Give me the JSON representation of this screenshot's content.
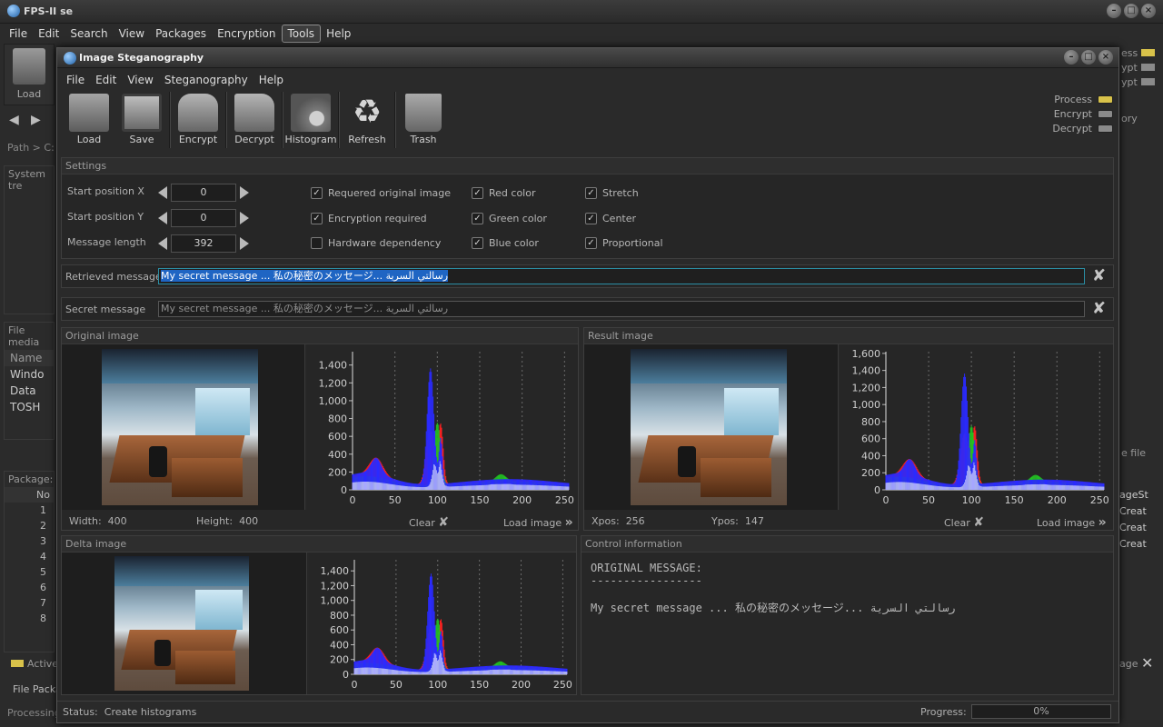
{
  "app": {
    "title": "FPS-II se",
    "menu": [
      "File",
      "Edit",
      "Search",
      "View",
      "Packages",
      "Encryption",
      "Tools",
      "Help"
    ],
    "active_menu": "Tools",
    "background": {
      "load_label": "Load",
      "path_label": "Path >",
      "path_value": "C:",
      "system_tree": "System tre",
      "file_media": "File media",
      "name_col": "Name",
      "drives": [
        "Windo",
        "Data",
        "TOSH"
      ],
      "package_label": "Package:",
      "no_col": "No",
      "rows": [
        "1",
        "2",
        "3",
        "4",
        "5",
        "6",
        "7",
        "8"
      ],
      "active_label": "Active",
      "file_package": "File Packa",
      "processing": "Processing",
      "right_frag": [
        "ess",
        "ypt",
        "ypt",
        "ory",
        "e file",
        "ageSt",
        "Creat",
        "Creat",
        "Creat",
        "age"
      ]
    }
  },
  "dialog": {
    "title": "Image Steganography",
    "menu": [
      "File",
      "Edit",
      "View",
      "Steganography",
      "Help"
    ],
    "toolbar": [
      {
        "label": "Load",
        "icon": "load-box-icon"
      },
      {
        "label": "Save",
        "icon": "floppy-disk-icon"
      },
      {
        "label": "Encrypt",
        "icon": "lock-icon"
      },
      {
        "label": "Decrypt",
        "icon": "unlock-icon"
      },
      {
        "label": "Histogram",
        "icon": "gear-chart-icon"
      },
      {
        "label": "Refresh",
        "icon": "recycle-icon"
      },
      {
        "label": "Trash",
        "icon": "trash-icon"
      }
    ],
    "indicators": [
      {
        "label": "Process",
        "color": "#d8c24a"
      },
      {
        "label": "Encrypt",
        "color": "#8a8a8a"
      },
      {
        "label": "Decrypt",
        "color": "#8a8a8a"
      }
    ],
    "settings": {
      "header": "Settings",
      "start_x_label": "Start position X",
      "start_x_value": "0",
      "start_y_label": "Start position Y",
      "start_y_value": "0",
      "msg_len_label": "Message length",
      "msg_len_value": "392",
      "checks": [
        {
          "label": "Requered original image",
          "checked": true
        },
        {
          "label": "Encryption required",
          "checked": true
        },
        {
          "label": "Hardware dependency",
          "checked": false
        },
        {
          "label": "Red color",
          "checked": true
        },
        {
          "label": "Green color",
          "checked": true
        },
        {
          "label": "Blue color",
          "checked": true
        },
        {
          "label": "Stretch",
          "checked": true
        },
        {
          "label": "Center",
          "checked": true
        },
        {
          "label": "Proportional",
          "checked": true
        }
      ]
    },
    "retrieved_label": "Retrieved message",
    "retrieved_value": "My secret message ... 私の秘密のメッセージ... رسالتي السرية",
    "secret_label": "Secret message",
    "secret_value": "My secret message ... 私の秘密のメッセージ... رسالتي السرية",
    "original": {
      "header": "Original image",
      "width_label": "Width:",
      "width_value": "400",
      "height_label": "Height:",
      "height_value": "400",
      "clear": "Clear",
      "load": "Load image"
    },
    "result": {
      "header": "Result image",
      "xpos_label": "Xpos:",
      "xpos_value": "256",
      "ypos_label": "Ypos:",
      "ypos_value": "147",
      "clear": "Clear",
      "load": "Load image"
    },
    "delta": {
      "header": "Delta image"
    },
    "control": {
      "header": "Control information",
      "line1": "ORIGINAL MESSAGE:",
      "line2": "-----------------",
      "line3": "My secret message ... 私の秘密のメッセージ... رسالتي السرية"
    },
    "status_label": "Status:",
    "status_value": "Create histograms",
    "progress_label": "Progress:",
    "progress_value": "0%"
  },
  "chart_data": [
    {
      "type": "area",
      "x_ticks": [
        0,
        50,
        100,
        150,
        200,
        250
      ],
      "y_ticks": [
        0,
        200,
        400,
        600,
        800,
        1000,
        1200,
        1400
      ],
      "xlim": [
        0,
        255
      ],
      "ylim": [
        0,
        1550
      ],
      "series": [
        {
          "color": "#ff2020"
        },
        {
          "color": "#22c022"
        },
        {
          "color": "#2a2aff"
        }
      ]
    },
    {
      "type": "area",
      "x_ticks": [
        0,
        50,
        100,
        150,
        200,
        250
      ],
      "y_ticks": [
        0,
        200,
        400,
        600,
        800,
        1000,
        1200,
        1400,
        1600
      ],
      "xlim": [
        0,
        255
      ],
      "ylim": [
        0,
        1620
      ],
      "series": [
        {
          "color": "#ff2020"
        },
        {
          "color": "#22c022"
        },
        {
          "color": "#2a2aff"
        }
      ]
    },
    {
      "type": "area",
      "x_ticks": [
        0,
        50,
        100,
        150,
        200,
        250
      ],
      "y_ticks": [
        0,
        200,
        400,
        600,
        800,
        1000,
        1200,
        1400
      ],
      "xlim": [
        0,
        255
      ],
      "ylim": [
        0,
        1550
      ],
      "series": [
        {
          "color": "#ff2020"
        },
        {
          "color": "#22c022"
        },
        {
          "color": "#2a2aff"
        }
      ]
    }
  ],
  "colors": {
    "accent": "#1f65c3",
    "panel": "#272727",
    "led_on": "#d8c24a"
  }
}
